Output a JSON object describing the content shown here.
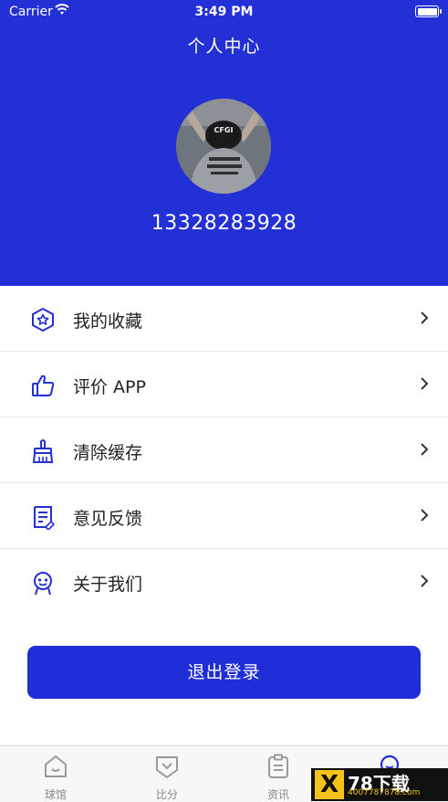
{
  "status_bar": {
    "carrier": "Carrier",
    "time": "3:49 PM"
  },
  "header": {
    "title": "个人中心",
    "phone": "13328283928",
    "avatar_text": "CFGI"
  },
  "menu": [
    {
      "label": "我的收藏",
      "icon": "star-shield-icon"
    },
    {
      "label": "评价 APP",
      "icon": "thumbs-up-icon"
    },
    {
      "label": "清除缓存",
      "icon": "broom-icon"
    },
    {
      "label": "意见反馈",
      "icon": "feedback-doc-icon"
    },
    {
      "label": "关于我们",
      "icon": "robot-face-icon"
    }
  ],
  "logout_label": "退出登录",
  "tabs": [
    {
      "label": "球馆",
      "icon": "house-icon"
    },
    {
      "label": "比分",
      "icon": "scoreboard-icon"
    },
    {
      "label": "资讯",
      "icon": "clipboard-icon"
    },
    {
      "label": "",
      "icon": "profile-icon"
    }
  ],
  "watermark": {
    "logo": "X",
    "main": "78下载",
    "sub": "4007787878.com"
  },
  "colors": {
    "primary": "#2330d6",
    "button": "#1f2ed6"
  }
}
